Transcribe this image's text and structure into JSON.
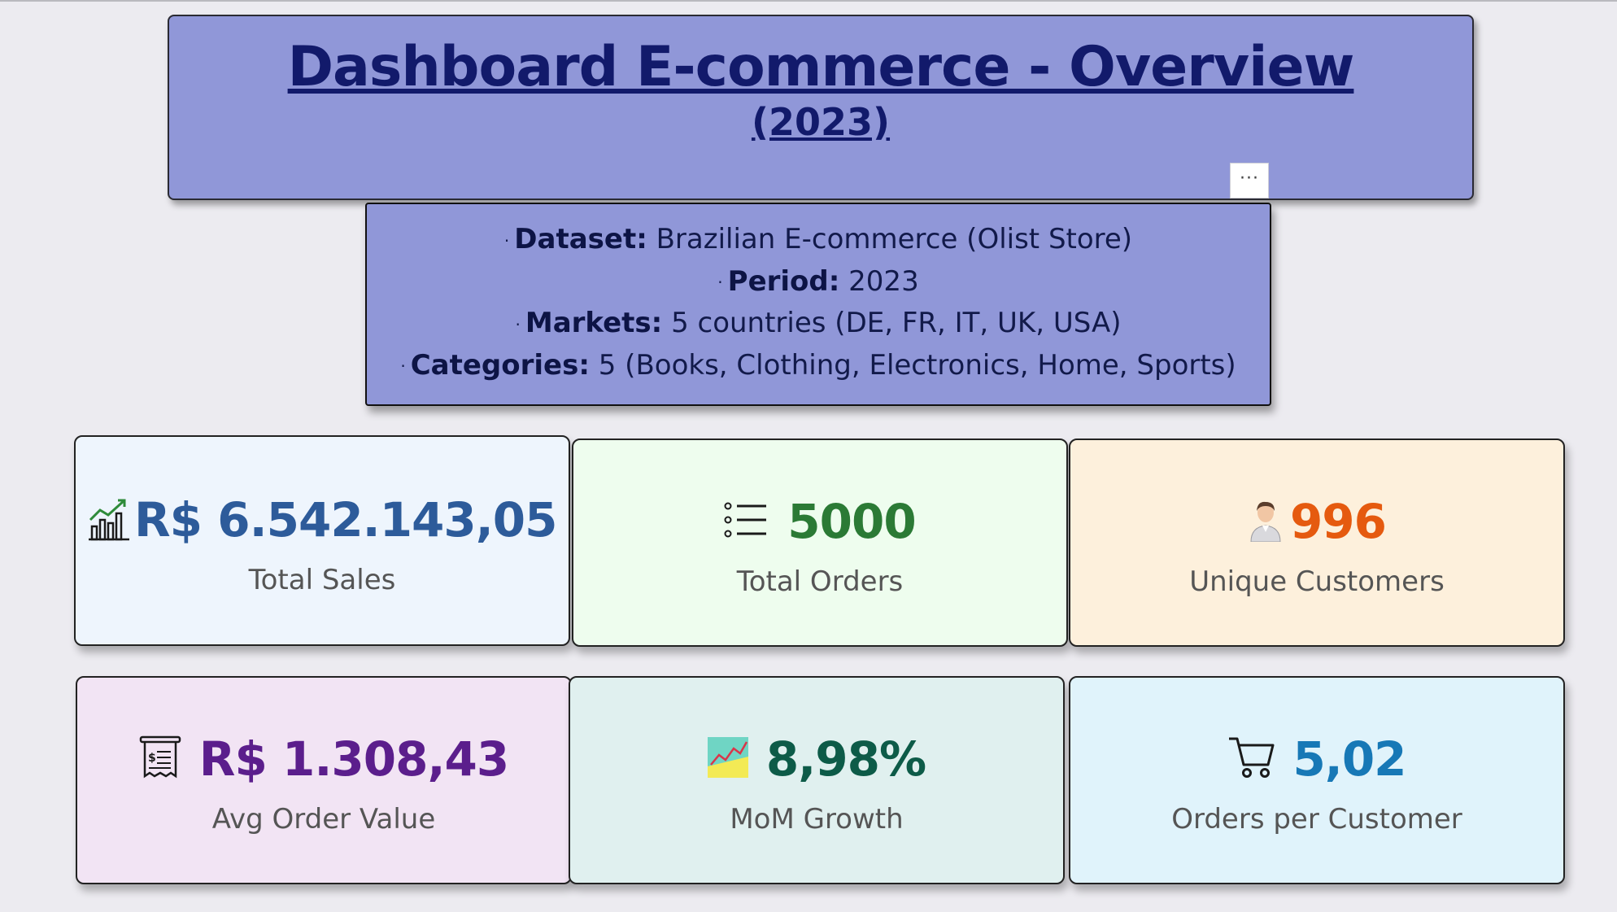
{
  "header": {
    "title": "Dashboard E-commerce - Overview",
    "subtitle": "(2023)",
    "more_label": "···"
  },
  "info": {
    "lines": [
      {
        "label": "Dataset:",
        "value": " Brazilian E-commerce (Olist Store)"
      },
      {
        "label": "Period:",
        "value": " 2023"
      },
      {
        "label": "Markets:",
        "value": " 5 countries (DE, FR, IT, UK, USA)"
      },
      {
        "label": "Categories:",
        "value": " 5 (Books, Clothing, Electronics, Home, Sports)"
      }
    ],
    "bullet": "·"
  },
  "kpis": [
    {
      "value": "R$ 6.542.143,05",
      "label": "Total Sales",
      "icon": "sales-chart-icon",
      "bg": "#eef5fd",
      "color": "#2d5b9a"
    },
    {
      "value": "5000",
      "label": "Total Orders",
      "icon": "list-icon",
      "bg": "#eefdee",
      "color": "#2b7a35"
    },
    {
      "value": "996",
      "label": "Unique Customers",
      "icon": "customer-icon",
      "bg": "#fdf0dc",
      "color": "#e55a0f"
    },
    {
      "value": "R$ 1.308,43",
      "label": "Avg Order Value",
      "icon": "receipt-icon",
      "bg": "#f2e4f4",
      "color": "#5b1e8c"
    },
    {
      "value": "8,98%",
      "label": "MoM Growth",
      "icon": "growth-chart-icon",
      "bg": "#e0f0ef",
      "color": "#0d5b48"
    },
    {
      "value": "5,02",
      "label": "Orders per Customer",
      "icon": "cart-icon",
      "bg": "#e0f3fb",
      "color": "#1778b6"
    }
  ]
}
